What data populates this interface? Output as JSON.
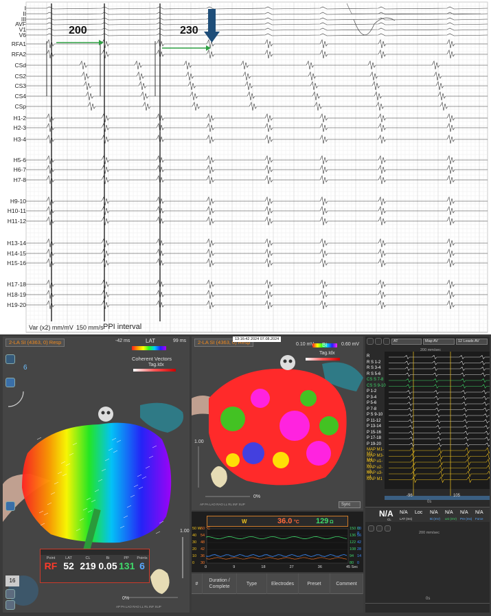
{
  "ecg": {
    "leads": [
      "I",
      "II",
      "III",
      "AVF",
      "V1",
      "V6",
      "RFA1",
      "RFA2",
      "CSd",
      "CS2",
      "CS3",
      "CS4",
      "CSp",
      "H1-2",
      "H2-3",
      "H3-4",
      "H5-6",
      "H6-7",
      "H7-8",
      "H9-10",
      "H10-11",
      "H11-12",
      "H13-14",
      "H14-15",
      "H15-16",
      "H17-18",
      "H18-19",
      "H19-20"
    ],
    "interval_1": "200",
    "interval_2": "230",
    "gain_label": "Var (x2) mm/mV",
    "speed_label": "150 mm/s",
    "ppi_label": "PPI interval"
  },
  "lat_map": {
    "title": "2-LA SI (4363, 0) Resp",
    "scale_min": "-42 ms",
    "scale_max": "99 ms",
    "scale_name": "LAT",
    "coherent_label": "Coherent Vectors",
    "tag_label": "Tag.Idx",
    "counter": "6",
    "slider_top": "1.00",
    "slider_bottom": "0%",
    "view_labels": "AP PA LAO RAO LL RL INF SUP",
    "page_number": "16",
    "info": {
      "rf_head": "Point",
      "rf_val": "RF",
      "lat_head": "LAT",
      "lat_val": "52",
      "cl_head": "CL",
      "cl_val": "219",
      "bi_head": "Bi",
      "bi_val": "0.05",
      "pp_head": "PP",
      "pp_val": "131",
      "fix_head": "Points",
      "fix_val": "6"
    }
  },
  "bi_map": {
    "title": "2-LA SI (4363, 0) Resp",
    "date": "13:16:42 2024 07.08.2024",
    "scale_min": "0.10 mV",
    "scale_max": "0.60 mV",
    "scale_name": "Bi",
    "tag_label": "Tag.Idx",
    "slider_top": "1.00",
    "slider_bottom": "0%",
    "view_labels": "AP PA LAO RAO LL RL INF SUP",
    "sync_label": "Sync"
  },
  "ablation": {
    "w_label": "W",
    "temp_value": "36.0",
    "temp_unit": "°C",
    "imp_value": "129",
    "imp_unit": "Ω",
    "left_axis": [
      "50 W",
      "40",
      "30",
      "20",
      "10",
      "0"
    ],
    "left_axis2": [
      "60 °C",
      "54",
      "48",
      "42",
      "36",
      "30"
    ],
    "right_axis": [
      "150 Ω",
      "136",
      "122",
      "108",
      "94",
      "80"
    ],
    "right_axis2": [
      "70 g",
      "56",
      "42",
      "28",
      "14",
      "0"
    ],
    "x_axis": [
      "0",
      "9",
      "18",
      "27",
      "36",
      "45 Sec"
    ]
  },
  "table": {
    "headers": [
      "#",
      "Duration / Complete",
      "Type",
      "Electrodes",
      "Preset",
      "Comment"
    ]
  },
  "right_ecg": {
    "dropdown1": "AT",
    "dropdown2": "Map AV",
    "dropdown3": "12 Leads AV",
    "speed_top": "200 mm/sec",
    "speed_bottom": "200 mm/sec",
    "leads": [
      "R",
      "R",
      "R",
      "R",
      "CS",
      "CS",
      "P",
      "P",
      "P",
      "P",
      "P",
      "P",
      "P",
      "P",
      "P",
      "P",
      "MAP",
      "MAP",
      "MAP",
      "MAP",
      "MAP",
      "MAP"
    ],
    "lead_suffixes": [
      "",
      "S 1-2",
      "S 3-4",
      "S 5-6",
      "S 7-8",
      "S 9-10",
      "1-2",
      "3-4",
      "5-6",
      "7-8",
      "S 9-10",
      "11-12",
      "13-14",
      "15-16",
      "17-18",
      "19-20",
      "M1-M2",
      "M3-M4",
      "u1-u2",
      "u2-u3",
      "u3-u4",
      "M1"
    ],
    "marker_left": "-96",
    "marker_right": "105",
    "zero_top": "0s",
    "zero_bottom": "0s",
    "na_main": "N/A",
    "na_main_sub": "CL",
    "na_cols": [
      {
        "val": "N/A",
        "head": "LAT (ms)"
      },
      {
        "val": "Loc",
        "head": ""
      },
      {
        "val": "N/A",
        "head": "Bi (mV)"
      },
      {
        "val": "N/A",
        "head": "uni (mV)"
      },
      {
        "val": "N/A",
        "head": "Pre (ms)"
      },
      {
        "val": "N/A",
        "head": "Force"
      }
    ]
  },
  "colors": {
    "orange": "#f28a1d",
    "green": "#3fd96b",
    "blue_arrow": "#1f4e79",
    "green_arrow": "#2ea043"
  }
}
